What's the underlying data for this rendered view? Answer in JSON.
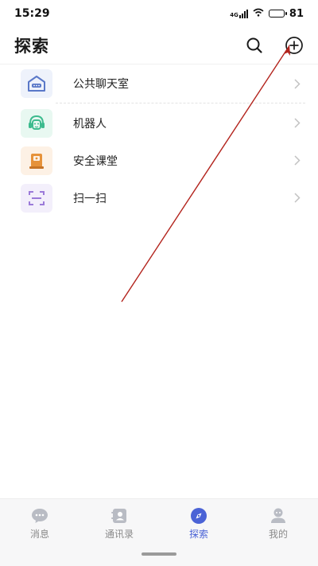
{
  "status": {
    "time": "15:29",
    "network": "4G",
    "battery": "81",
    "battery_level": 0.81
  },
  "header": {
    "title": "探索"
  },
  "list": {
    "items": [
      {
        "label": "公共聊天室",
        "icon": "chat-room-icon",
        "color": "#5a78c8",
        "bg": "#eef2fb"
      },
      {
        "label": "机器人",
        "icon": "robot-icon",
        "color": "#3dbb8e",
        "bg": "#e8f8f1"
      },
      {
        "label": "安全课堂",
        "icon": "classroom-book-icon",
        "color": "#e6923a",
        "bg": "#fdf1e5"
      },
      {
        "label": "扫一扫",
        "icon": "scan-icon",
        "color": "#9b7ad9",
        "bg": "#f3effb"
      }
    ]
  },
  "tabbar": {
    "tabs": [
      {
        "label": "消息",
        "icon": "message-icon",
        "active": false
      },
      {
        "label": "通讯录",
        "icon": "contacts-icon",
        "active": false
      },
      {
        "label": "探索",
        "icon": "compass-icon",
        "active": true
      },
      {
        "label": "我的",
        "icon": "profile-icon",
        "active": false
      }
    ]
  },
  "colors": {
    "accent": "#4b63d6",
    "annotation": "#b3241d"
  }
}
